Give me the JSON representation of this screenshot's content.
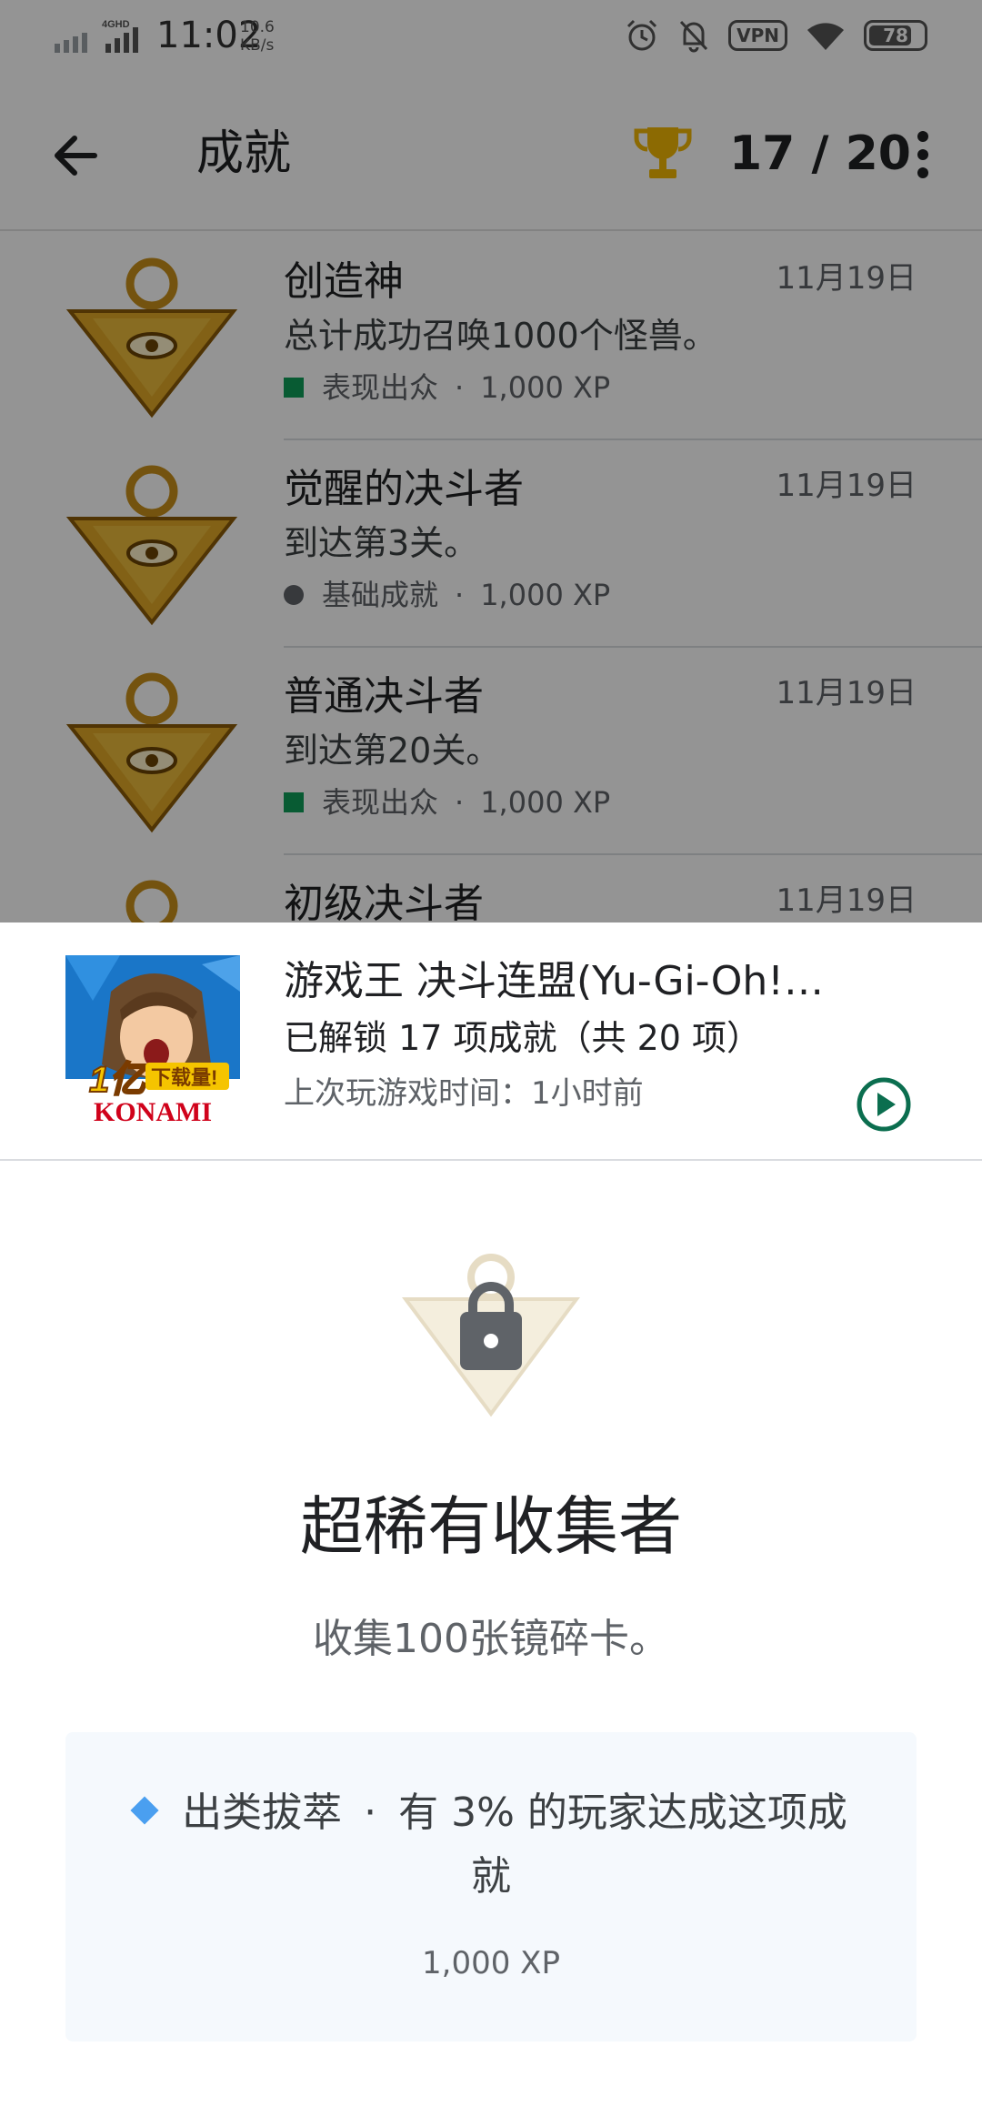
{
  "status_bar": {
    "network": "4GHD",
    "time": "11:02",
    "speed_value": "10.6",
    "speed_unit": "KB/s",
    "vpn_label": "VPN",
    "battery": "78"
  },
  "app_bar": {
    "title": "成就",
    "count": "17 / 20"
  },
  "achievements": [
    {
      "title": "创造神",
      "date": "11月19日",
      "description": "总计成功召唤1000个怪兽。",
      "rarity": "表现出众",
      "xp": "1,000 XP",
      "marker": "square",
      "marker_color": "#0f9d58"
    },
    {
      "title": "觉醒的决斗者",
      "date": "11月19日",
      "description": "到达第3关。",
      "rarity": "基础成就",
      "xp": "1,000 XP",
      "marker": "circle",
      "marker_color": "#5f6368"
    },
    {
      "title": "普通决斗者",
      "date": "11月19日",
      "description": "到达第20关。",
      "rarity": "表现出众",
      "xp": "1,000 XP",
      "marker": "square",
      "marker_color": "#0f9d58"
    },
    {
      "title": "初级决斗者",
      "date": "11月19日"
    }
  ],
  "separator": "·",
  "game": {
    "title": "游戏王 决斗连盟(Yu-Gi-Oh! Duel Links)",
    "progress": "已解锁 17 项成就（共 20 项）",
    "last_played": "上次玩游戏时间：1小时前",
    "icon_text_top": "1亿",
    "icon_text_badge": "下载量!",
    "icon_text_brand": "KONAMI"
  },
  "detail": {
    "title": "超稀有收集者",
    "description": "收集100张镜碎卡。",
    "rarity": "出类拔萃",
    "stat": "有 3% 的玩家达成这项成就",
    "xp": "1,000 XP"
  },
  "colors": {
    "accent_green": "#0f9d58",
    "play_green": "#0b6e4f",
    "diamond_blue": "#4a9ff0",
    "badge_gold": "#d9a520"
  }
}
